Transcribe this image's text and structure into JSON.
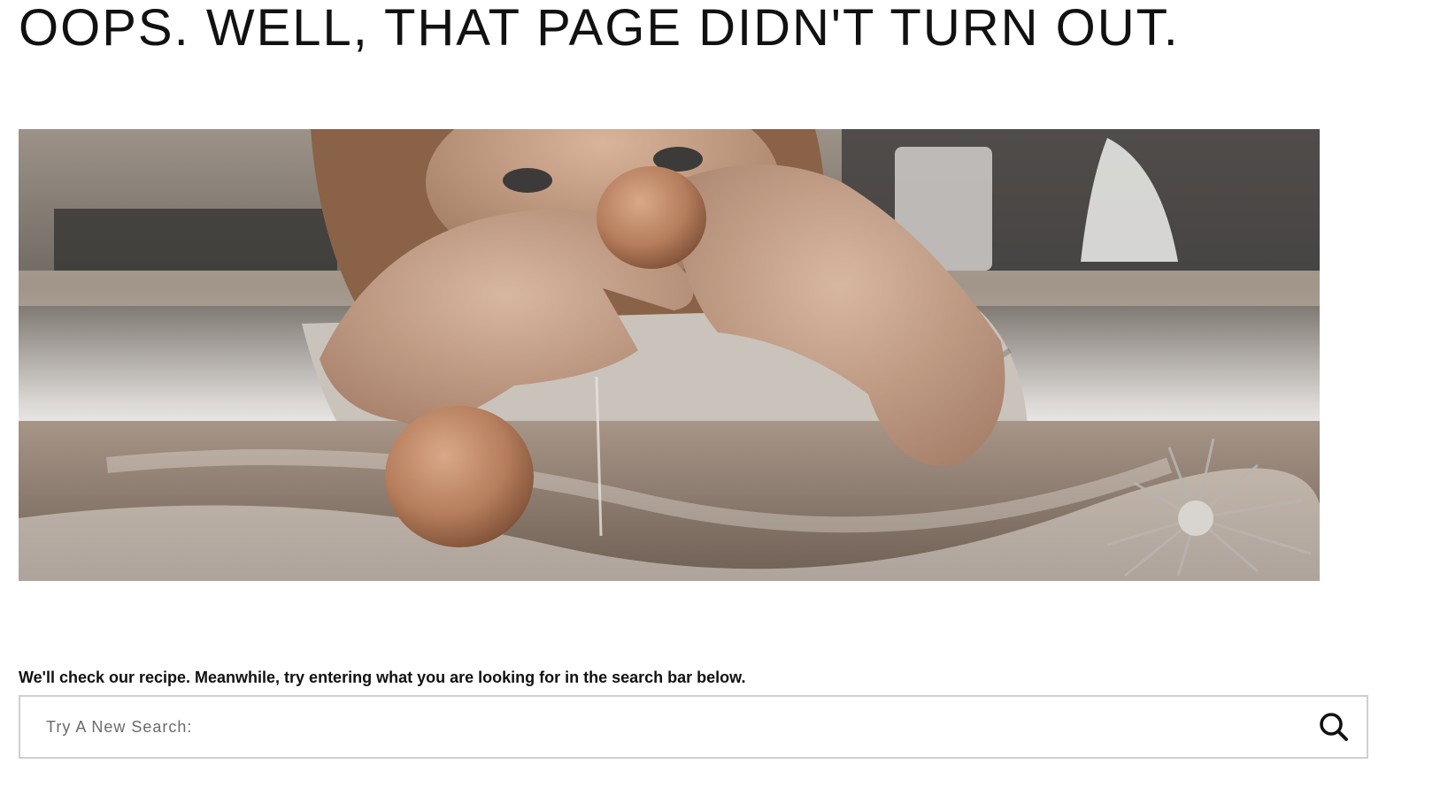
{
  "page": {
    "title": "OOPS. WELL, THAT PAGE DIDN'T TURN OUT.",
    "message": "We'll check our recipe. Meanwhile, try entering what you are looking for in the search bar below."
  },
  "hero": {
    "description": "child-cracking-egg-photo"
  },
  "search": {
    "placeholder": "Try A New Search:",
    "value": "",
    "icon": "search-icon"
  },
  "colors": {
    "text": "#111111",
    "border": "#cfcfcf",
    "placeholder": "#6b6b6b"
  }
}
